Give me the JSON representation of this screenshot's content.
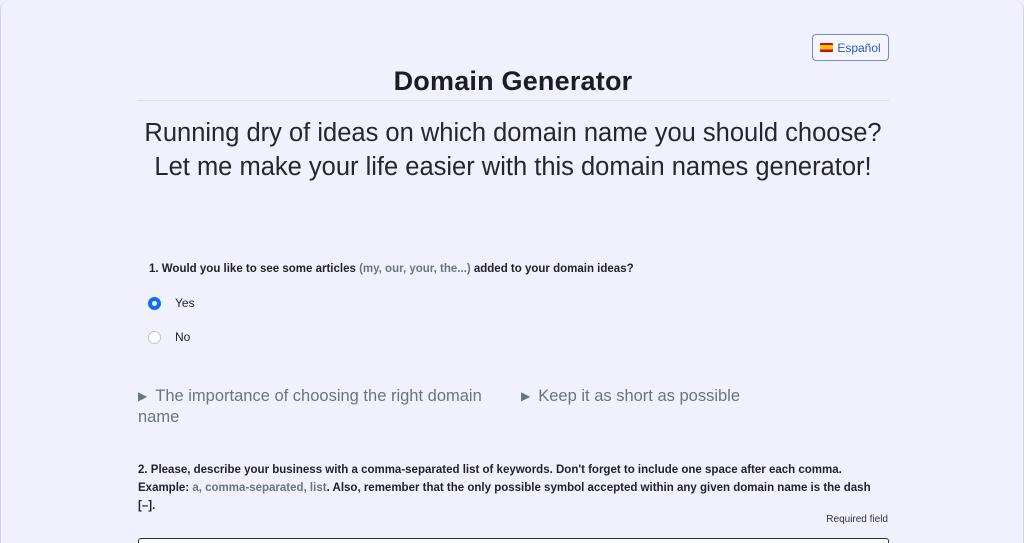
{
  "header": {
    "language_button": "Español",
    "language_flag_icon": "spain-flag-icon",
    "title": "Domain Generator",
    "subtitle": "Running dry of ideas on which domain name you should choose? Let me make your life easier with this domain names generator!"
  },
  "question1": {
    "prefix": "1. Would you like to see some articles ",
    "examples": "(my, our, your, the...)",
    "suffix": " added to your domain ideas?",
    "options": [
      {
        "label": "Yes",
        "selected": true
      },
      {
        "label": "No",
        "selected": false
      }
    ]
  },
  "tips": [
    {
      "label": "The importance of choosing the right domain name"
    },
    {
      "label": "Keep it as short as possible"
    }
  ],
  "question2": {
    "line1": "2. Please, describe your business with a comma-separated list of keywords. Don't forget to include one space after each comma.",
    "example_prefix": "Example: ",
    "example_value": "a, comma-separated, list",
    "example_suffix": ". Also, remember that the only possible symbol accepted within any given domain name is the dash",
    "dash_symbol": "[–]",
    "end": "."
  },
  "required_label": "Required field",
  "colors": {
    "background": "#f0f1fc",
    "accent": "#0d6efd",
    "muted": "#6c757d"
  }
}
